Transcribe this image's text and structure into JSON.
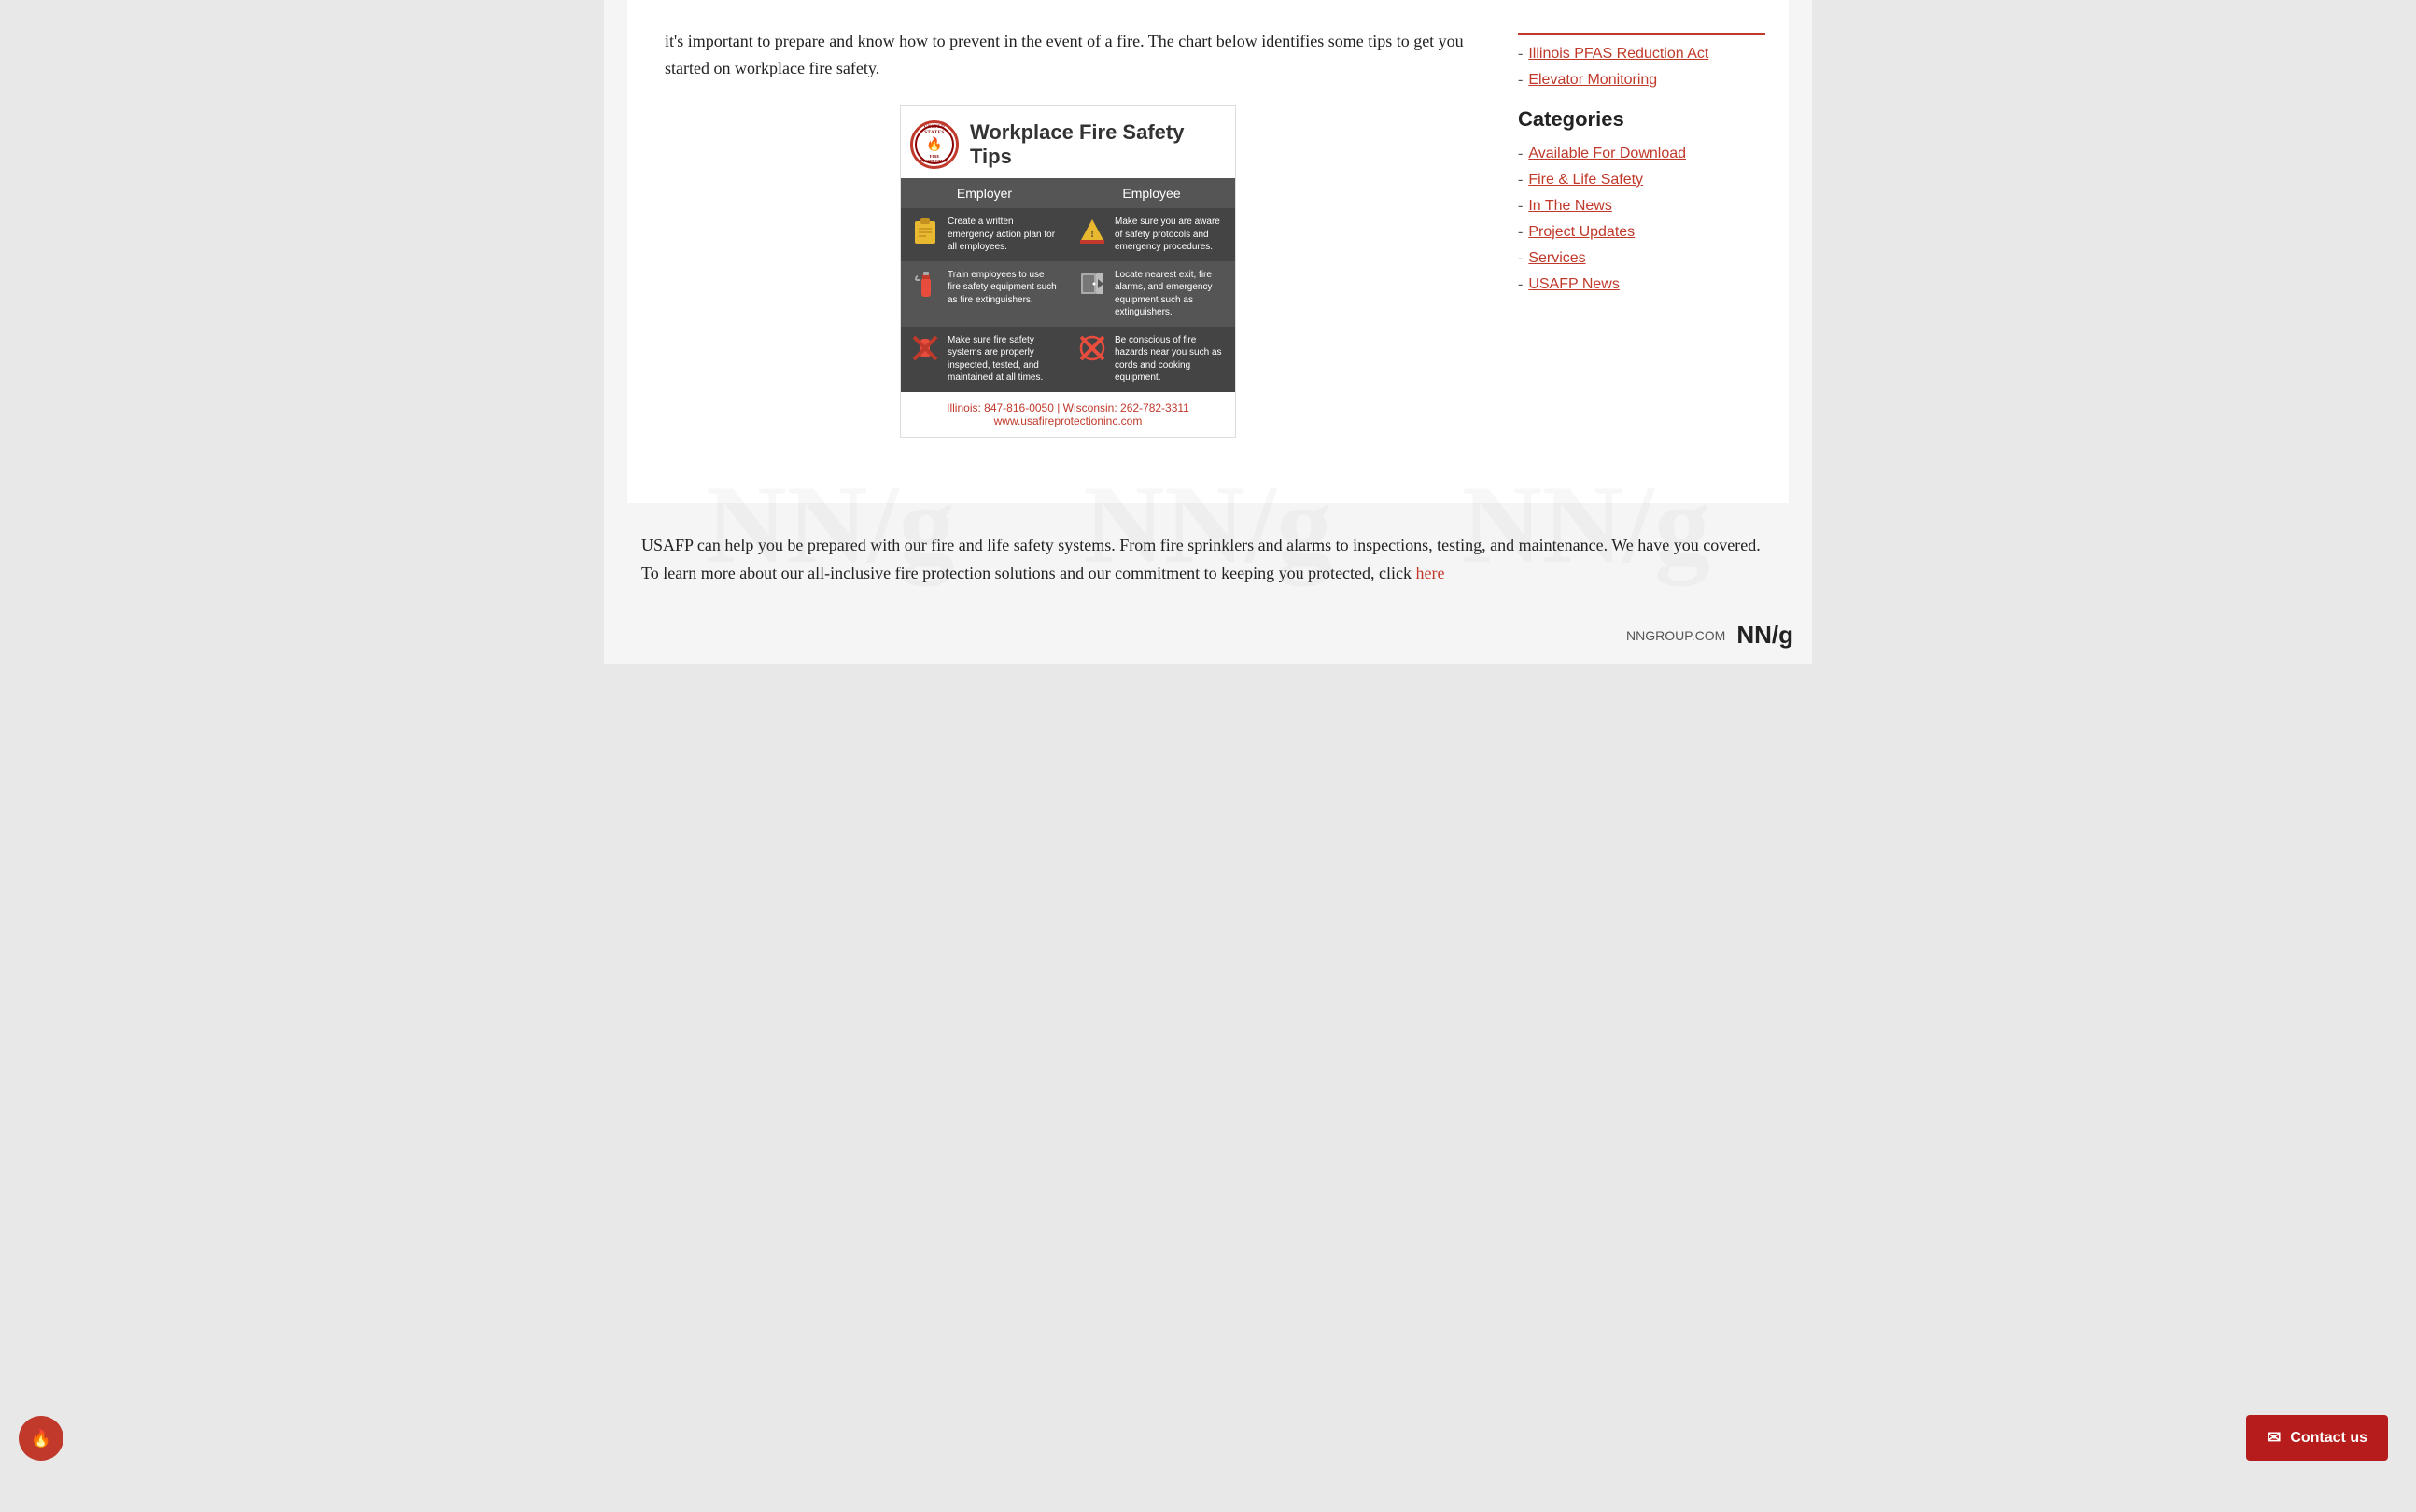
{
  "intro": {
    "text": "it's important to prepare and know how to prevent in the event of a fire. The chart below identifies some tips to get you started on workplace fire safety."
  },
  "infographic": {
    "title": "Workplace Fire Safety Tips",
    "badge_alt": "United States Fire Protection",
    "columns": [
      "Employer",
      "Employee"
    ],
    "rows": [
      {
        "employer_text": "Create a written emergency action plan for all employees.",
        "employee_text": "Make sure you are aware of safety protocols and emergency procedures."
      },
      {
        "employer_text": "Train employees to use fire safety equipment such as fire extinguishers.",
        "employee_text": "Locate nearest exit, fire alarms, and emergency equipment such as extinguishers."
      },
      {
        "employer_text": "Make sure fire safety systems are properly inspected, tested, and maintained at all times.",
        "employee_text": "Be conscious of fire hazards near you such as cords and cooking equipment."
      }
    ],
    "footer_phone": "Illinois: 847-816-0050  |  Wisconsin: 262-782-3311",
    "footer_website": "www.usafireprotectioninc.com"
  },
  "sidebar": {
    "links": [
      {
        "label": "Illinois PFAS Reduction Act",
        "id": "illinois-pfas"
      },
      {
        "label": "Elevator Monitoring",
        "id": "elevator-monitoring"
      }
    ],
    "categories_heading": "Categories",
    "categories": [
      {
        "label": "Available For Download",
        "id": "available-download"
      },
      {
        "label": "Fire & Life Safety",
        "id": "fire-life-safety"
      },
      {
        "label": "In The News",
        "id": "in-the-news"
      },
      {
        "label": "Project Updates",
        "id": "project-updates"
      },
      {
        "label": "Services",
        "id": "services"
      },
      {
        "label": "USAFP News",
        "id": "usafp-news"
      }
    ]
  },
  "bottom_text": "USAFP can help you be prepared with our fire and life safety systems. From fire sprinklers and alarms to inspections, testing, and maintenance. We have you covered. To learn more about our all-inclusive fire protection solutions and our commitment to keeping you protected, click",
  "bottom_here_link": "here",
  "contact_button_label": "Contact us",
  "nngroup": {
    "url_label": "NNGROUP.COM",
    "logo_label": "NN/g"
  }
}
